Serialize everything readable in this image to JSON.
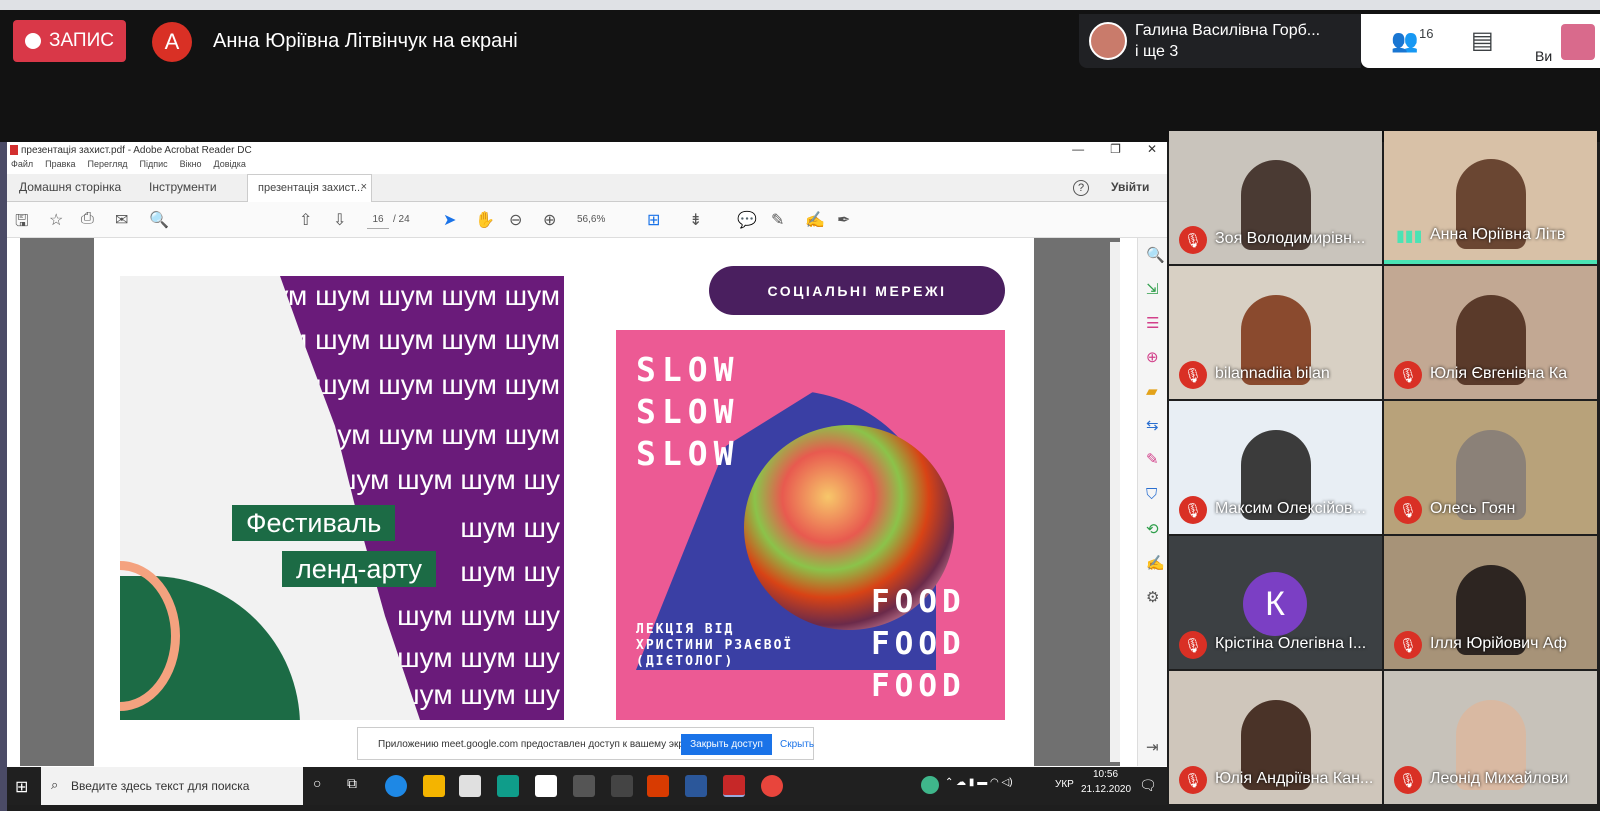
{
  "meet": {
    "record_label": "ЗАПИС",
    "presenter_initial": "А",
    "presenter_text": "Анна Юріївна Літвінчук на екрані",
    "speaker_name": "Галина Василівна Горб...",
    "speaker_more": "і ще 3",
    "participants_count": "16",
    "you_label": "Ви"
  },
  "acrobat": {
    "title": "презентація захист.pdf - Adobe Acrobat Reader DC",
    "menu": [
      "Файл",
      "Правка",
      "Перегляд",
      "Підпис",
      "Вікно",
      "Довідка"
    ],
    "tab_home": "Домашня сторінка",
    "tab_tools": "Інструменти",
    "tab_doc": "презентація захист...",
    "tab_doc_close": "×",
    "help": "?",
    "signin": "Увійти",
    "page_current": "16",
    "page_total": "/ 24",
    "zoom": "56,6%",
    "window_controls": [
      "—",
      "❐",
      "✕"
    ]
  },
  "slide": {
    "shum_lines": [
      "шум шум шум шум шум",
      "шум шум шум шум шум",
      "шум шум шум шум",
      "шум шум шум шум",
      "шум шум шум шу",
      "шум шу",
      "шум шу",
      "шум шум шу",
      "шум шум шу",
      "шум шум шу"
    ],
    "festival_line1": "Фестиваль",
    "festival_line2": "ленд-арту",
    "social_button": "СОЦІАЛЬНІ МЕРЕЖІ",
    "slow": [
      "SLOW",
      "SLOW",
      "SLOW"
    ],
    "food": [
      "FOOD",
      "FOOD",
      "FOOD"
    ],
    "lecture": [
      "ЛЕКЦІЯ ВІД",
      "ХРИСТИНИ РЗАЄВОЇ",
      "(ДІЄТОЛОГ)"
    ]
  },
  "share_bar": {
    "text": "Приложению meet.google.com предоставлен доступ к вашему экрану.",
    "stop": "Закрыть доступ",
    "hide": "Скрыть"
  },
  "taskbar": {
    "search_placeholder": "Введите здесь текст для поиска",
    "lang": "УКР",
    "time": "10:56",
    "date": "21.12.2020"
  },
  "participants": [
    {
      "name": "Зоя Володимирівн...",
      "muted": true
    },
    {
      "name": "Анна Юріївна Літв",
      "muted": false
    },
    {
      "name": "bilannadiia bilan",
      "muted": true
    },
    {
      "name": "Юлія Євгенівна Ка",
      "muted": true
    },
    {
      "name": "Максим Олексійов...",
      "muted": true
    },
    {
      "name": "Олесь Гоян",
      "muted": true
    },
    {
      "name": "Крістіна Олегівна І...",
      "muted": true,
      "initial": "К"
    },
    {
      "name": "Ілля Юрійович Аф",
      "muted": true
    },
    {
      "name": "Юлія Андріївна Кан...",
      "muted": true
    },
    {
      "name": "Леонід Михайлови",
      "muted": true
    }
  ],
  "colors": {
    "record_red": "#d93848",
    "slide_purple": "#6a1b7a",
    "slide_green": "#1c6b45",
    "slide_pink": "#ec5a94",
    "button_purple": "#4a1f5f",
    "share_blue": "#1a73e8"
  }
}
